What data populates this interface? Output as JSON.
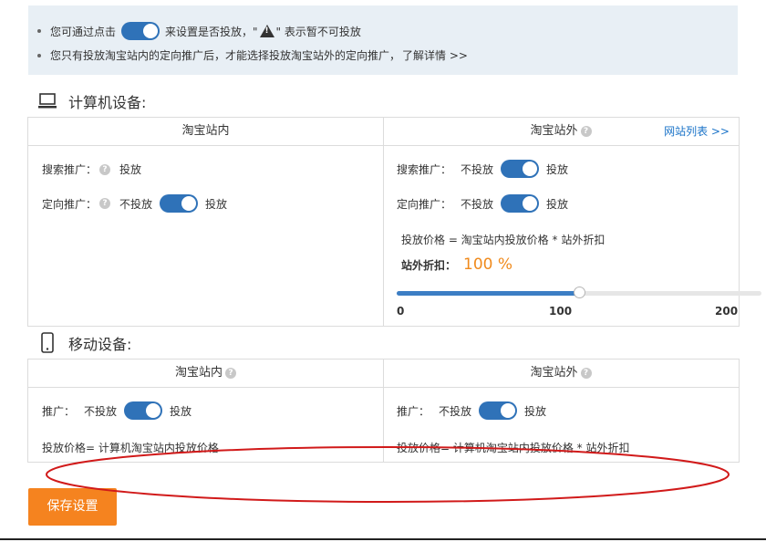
{
  "tips": {
    "line1_prefix": "您可通过点击",
    "line1_middle": "来设置是否投放，\"",
    "line1_suffix": "\" 表示暂不可投放",
    "line2_text": "您只有投放淘宝站内的定向推广后，才能选择投放淘宝站外的定向推广，",
    "line2_link": "了解详情 >>"
  },
  "pc": {
    "title": "计算机设备:",
    "left_head": "淘宝站内",
    "right_head": "淘宝站外",
    "site_list_link": "网站列表 >>",
    "left": {
      "search_label": "搜索推广：",
      "search_value": "投放",
      "targeted_label": "定向推广：",
      "targeted_off": "不投放",
      "targeted_on": "投放"
    },
    "right": {
      "search_label": "搜索推广：",
      "search_off": "不投放",
      "search_on": "投放",
      "targeted_label": "定向推广：",
      "targeted_off": "不投放",
      "targeted_on": "投放",
      "price_formula": "投放价格 = 淘宝站内投放价格 * 站外折扣",
      "discount_label": "站外折扣：",
      "discount_value": "100 %",
      "slider_value": 100,
      "slider_min": "0",
      "slider_mid": "100",
      "slider_max": "200"
    }
  },
  "mobile": {
    "title": "移动设备:",
    "left_head": "淘宝站内",
    "right_head": "淘宝站外",
    "left": {
      "label": "推广：",
      "off": "不投放",
      "on": "投放",
      "price": "投放价格= 计算机淘宝站内投放价格"
    },
    "right": {
      "label": "推广：",
      "off": "不投放",
      "on": "投放",
      "price": "投放价格= 计算机淘宝站内投放价格 * 站外折扣"
    }
  },
  "save_button": "保存设置",
  "colors": {
    "accent": "#2f72b8",
    "orange": "#f08a1c",
    "button": "#f5831f",
    "annotation": "#d11a1a"
  }
}
